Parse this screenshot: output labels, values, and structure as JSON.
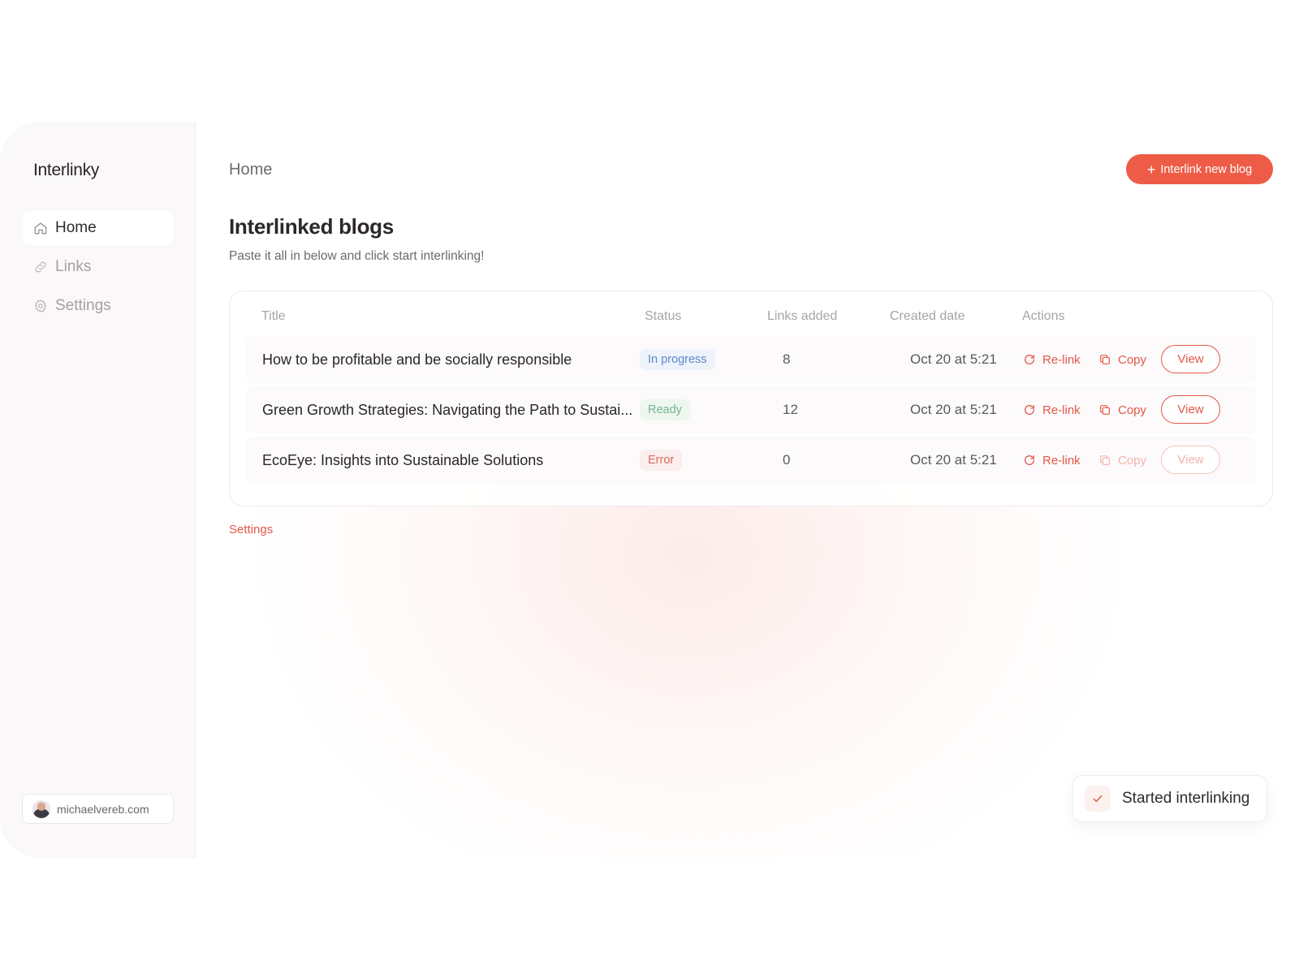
{
  "sidebar": {
    "brand": "Interlinky",
    "items": [
      {
        "label": "Home",
        "icon": "home-icon",
        "active": true
      },
      {
        "label": "Links",
        "icon": "link-icon",
        "active": false
      },
      {
        "label": "Settings",
        "icon": "gear-icon",
        "active": false
      }
    ],
    "user": "michaelvereb.com"
  },
  "header": {
    "breadcrumb": "Home",
    "cta_label": "Interlink new blog"
  },
  "main": {
    "title": "Interlinked blogs",
    "subtitle": "Paste it all in below and click start interlinking!",
    "settings_link": "Settings"
  },
  "table": {
    "columns": [
      "Title",
      "Status",
      "Links added",
      "Created date",
      "Actions"
    ],
    "rows": [
      {
        "title": "How to be profitable and be socially responsible",
        "status": "In progress",
        "status_kind": "progress",
        "links": "8",
        "date": "Oct 20 at 5:21",
        "relink": "Re-link",
        "copy": "Copy",
        "view": "View",
        "enabled": true
      },
      {
        "title": "Green Growth Strategies: Navigating the Path to Sustai...",
        "status": "Ready",
        "status_kind": "ready",
        "links": "12",
        "date": "Oct 20 at 5:21",
        "relink": "Re-link",
        "copy": "Copy",
        "view": "View",
        "enabled": true
      },
      {
        "title": "EcoEye: Insights into Sustainable Solutions",
        "status": "Error",
        "status_kind": "error",
        "links": "0",
        "date": "Oct 20 at 5:21",
        "relink": "Re-link",
        "copy": "Copy",
        "view": "View",
        "enabled": false
      }
    ]
  },
  "toast": {
    "message": "Started interlinking",
    "icon": "check-icon"
  },
  "colors": {
    "accent": "#ee5c47",
    "status_progress": "#5b89c9",
    "status_ready": "#79b48e",
    "status_error": "#d96a5e"
  }
}
